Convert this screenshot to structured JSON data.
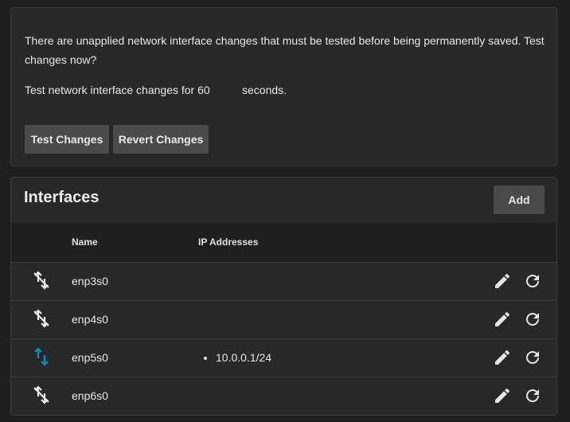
{
  "notice": {
    "message": "There are unapplied network interface changes that must be tested before being permanently saved. Test changes now?",
    "test_prefix": "Test network interface changes for",
    "duration_value": "60",
    "test_suffix": "seconds.",
    "test_button": "Test Changes",
    "revert_button": "Revert Changes"
  },
  "interfaces": {
    "title": "Interfaces",
    "add_button": "Add",
    "columns": {
      "name": "Name",
      "ip": "IP Addresses"
    },
    "rows": [
      {
        "name": "enp3s0",
        "state": "link-down",
        "ips": []
      },
      {
        "name": "enp4s0",
        "state": "link-down",
        "ips": []
      },
      {
        "name": "enp5s0",
        "state": "link-up",
        "ips": [
          "10.0.0.1/24"
        ]
      },
      {
        "name": "enp6s0",
        "state": "link-down",
        "ips": []
      }
    ]
  },
  "colors": {
    "link_up": "#0b8ec2",
    "link_down": "#e6e6e6"
  }
}
